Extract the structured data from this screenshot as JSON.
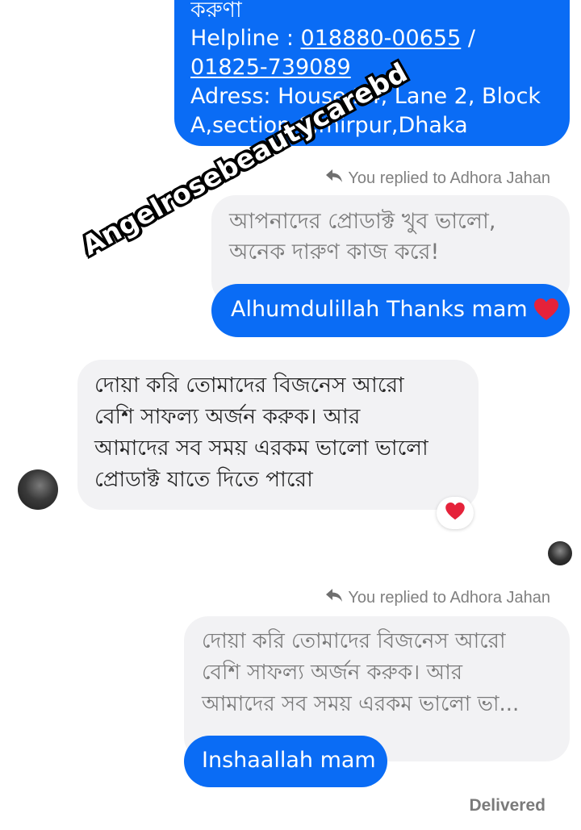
{
  "messages": {
    "m1": {
      "cut_top_text": "করুণা",
      "helpline_label": "Helpline : ",
      "phone1": "018880-00655",
      "phone_sep": " /",
      "phone2": "01825-739089",
      "address_line1": "Adress: House 24, Lane 2, Block",
      "address_line2": "A,section 6,mirpur,Dhaka"
    },
    "reply1": {
      "note": "You replied to Adhora Jahan",
      "quoted_line1": "আপনাদের প্রোডাক্ট খুব ভালো,",
      "quoted_line2": "অনেক দারুণ কাজ করে!",
      "text": "Alhumdulillah Thanks mam"
    },
    "incoming1": {
      "line1": "দোয়া করি তোমাদের বিজনেস আরো",
      "line2": "বেশি সাফল্য অর্জন করুক। আর",
      "line3": "আমাদের সব সময় এরকম ভালো ভালো",
      "line4": "প্রোডাক্ট যাতে দিতে পারো"
    },
    "reply2": {
      "note": "You replied to Adhora Jahan",
      "quoted_line1": "দোয়া করি তোমাদের বিজনেস আরো",
      "quoted_line2": "বেশি সাফল্য অর্জন করুক। আর",
      "quoted_line3": "আমাদের সব সময় এরকম ভালো ভা...",
      "text": "Inshaallah mam"
    }
  },
  "status": "Delivered",
  "watermark": "Angelrosebeautycarebd",
  "icons": {
    "heart": "red-heart-emoji",
    "reply": "reply-arrow-icon",
    "avatar": "contact-avatar"
  },
  "colors": {
    "outgoing_bubble": "#0a6cf5",
    "incoming_bubble": "#f2f2f4",
    "heart": "#e5223a"
  }
}
